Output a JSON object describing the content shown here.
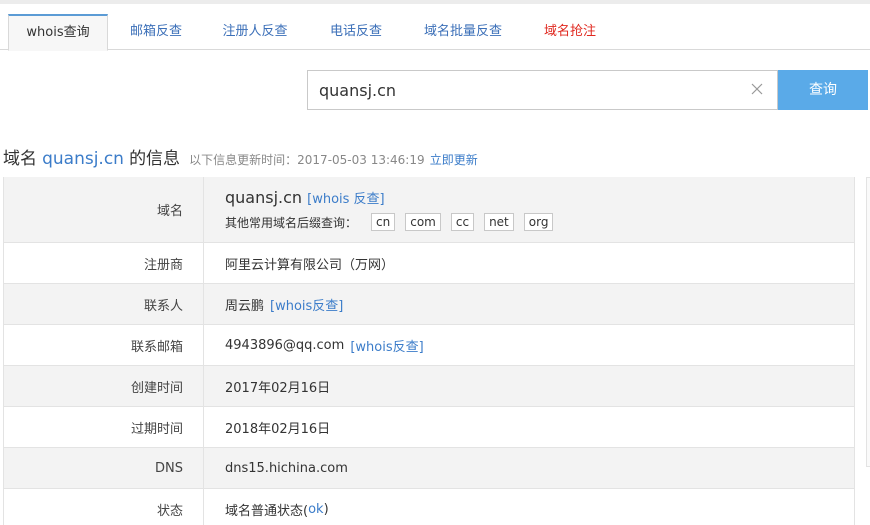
{
  "tabs": [
    {
      "label": "whois查询"
    },
    {
      "label": "邮箱反查"
    },
    {
      "label": "注册人反查"
    },
    {
      "label": "电话反查"
    },
    {
      "label": "域名批量反查"
    },
    {
      "label": "域名抢注"
    }
  ],
  "search": {
    "value": "quansj.cn",
    "button_label": "查询"
  },
  "heading": {
    "prefix": "域名",
    "domain": "quansj.cn",
    "suffix": "的信息",
    "update_text": "以下信息更新时间：2017-05-03 13:46:19",
    "refresh_label": "立即更新"
  },
  "rows": {
    "domain": {
      "label": "域名",
      "value": "quansj.cn",
      "whois_link": "[whois 反查]",
      "suffix_prompt": "其他常用域名后缀查询：",
      "suffixes": [
        "cn",
        "com",
        "cc",
        "net",
        "org"
      ]
    },
    "registrar": {
      "label": "注册商",
      "value": "阿里云计算有限公司（万网）"
    },
    "contact": {
      "label": "联系人",
      "value": "周云鹏",
      "whois_link": "[whois反查]"
    },
    "email": {
      "label": "联系邮箱",
      "value": "4943896@qq.com",
      "whois_link": "[whois反查]"
    },
    "created": {
      "label": "创建时间",
      "value": "2017年02月16日"
    },
    "expires": {
      "label": "过期时间",
      "value": "2018年02月16日"
    },
    "dns": {
      "label": "DNS",
      "value": "dns15.hichina.com"
    },
    "status": {
      "label": "状态",
      "value_prefix": "域名普通状态(",
      "value_link": "ok",
      "value_suffix": ")"
    }
  },
  "colors": {
    "accent": "#5aaae8",
    "link": "#3b7cc9",
    "red_tab": "#e0281f"
  },
  "icons": {
    "clear": "close-icon"
  }
}
